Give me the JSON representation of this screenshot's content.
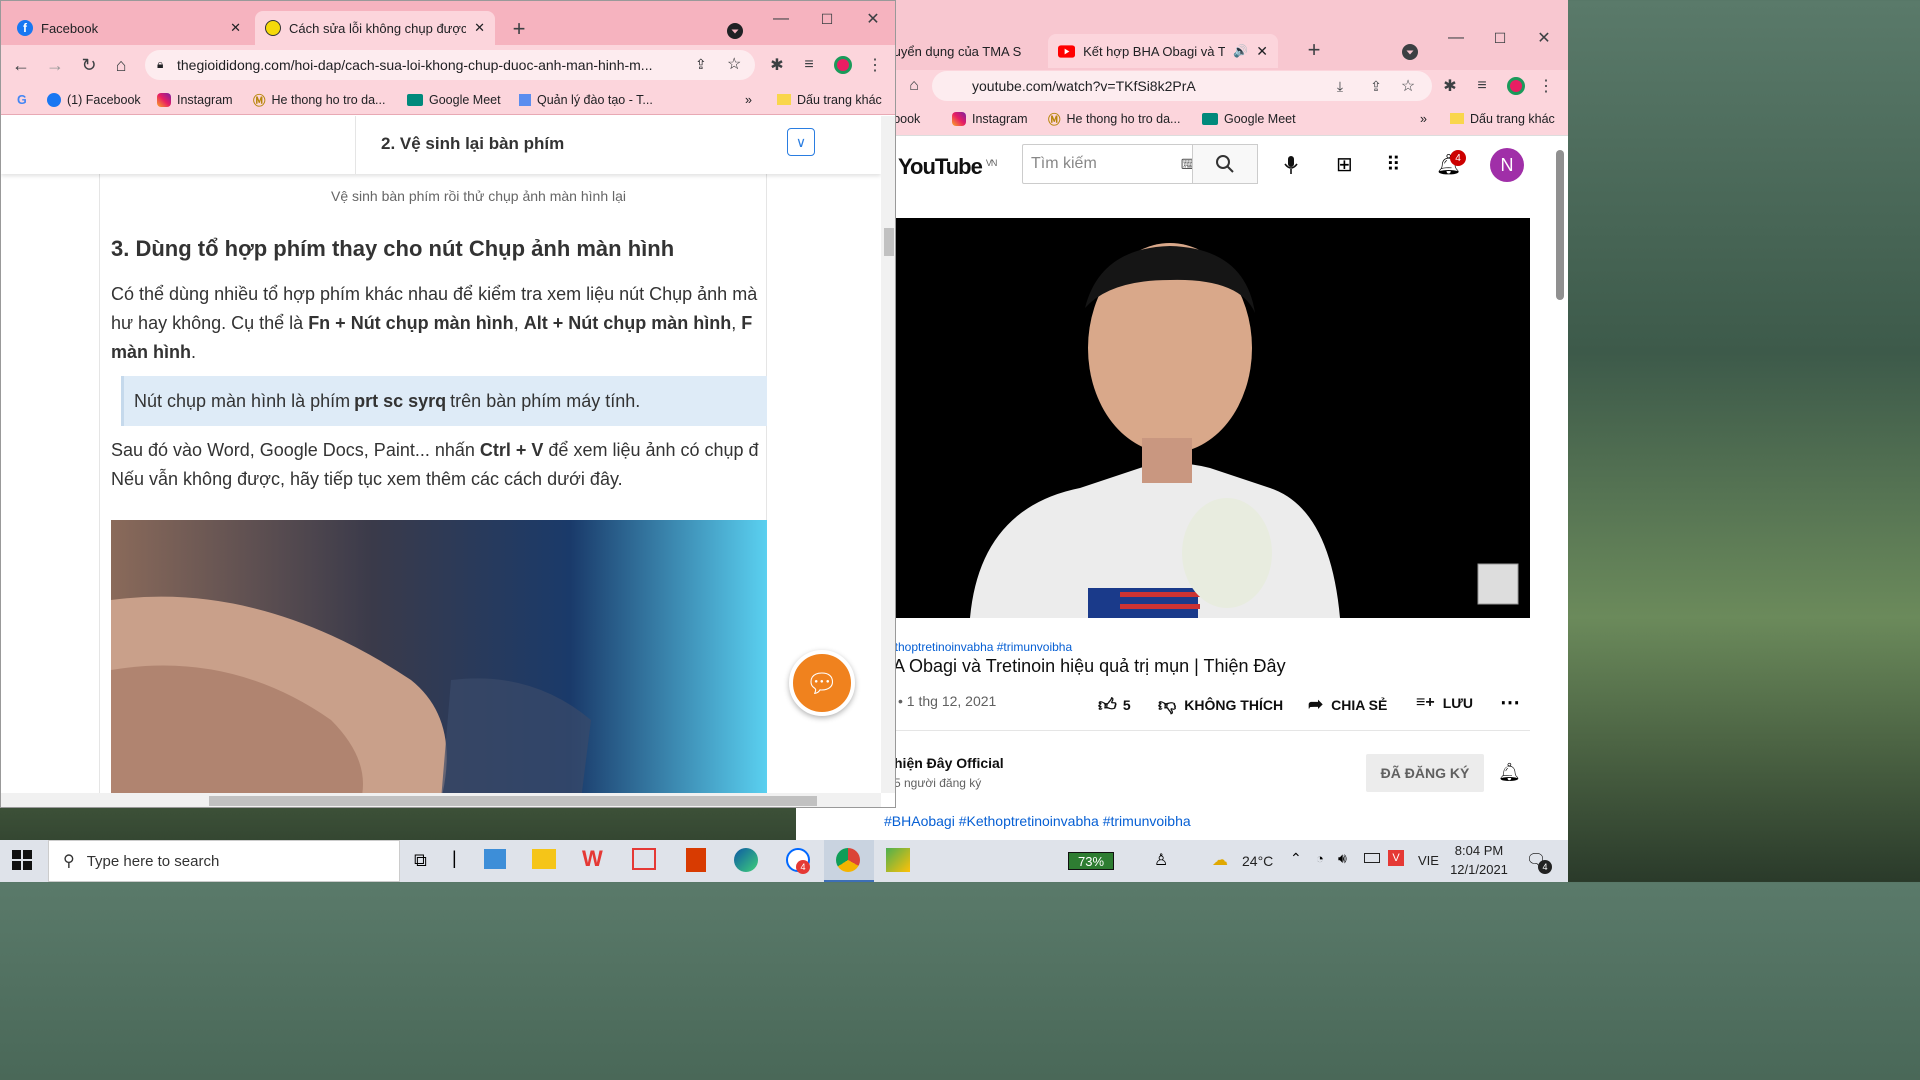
{
  "right_window": {
    "tabs": [
      {
        "label": "tuyển dụng của TMA S"
      },
      {
        "label": "Kết hợp BHA Obagi và Tretin"
      }
    ],
    "url": "youtube.com/watch?v=TKfSi8k2PrA",
    "bookmarks": [
      "cebook",
      "Instagram",
      "He thong ho tro da...",
      "Google Meet",
      "»",
      "Dấu trang khác"
    ],
    "yt": {
      "logo": "YouTube",
      "region": "VN",
      "search_placeholder": "Tìm kiếm",
      "notif_count": "4",
      "avatar_letter": "N",
      "hashtags": "Kethoptretinoinvabha #trimunvoibha",
      "title": "HA Obagi và Tretinoin hiệu quả trị mụn | Thiện Đây",
      "date": "• 1 thg 12, 2021",
      "likes": "5",
      "dislike": "KHÔNG THÍCH",
      "share": "CHIA SẺ",
      "save": "LƯU",
      "channel": "hiện Đây Official",
      "subs": "5 người đăng ký",
      "subscribed": "ĐÃ ĐĂNG KÝ",
      "desc_tags": "#BHAobagi #Kethoptretinoinvabha #trimunvoibha"
    }
  },
  "left_window": {
    "tabs": [
      {
        "label": "Facebook"
      },
      {
        "label": "Cách sửa lỗi không chụp được ản"
      }
    ],
    "url": "thegioididong.com/hoi-dap/cach-sua-loi-khong-chup-duoc-anh-man-hinh-m...",
    "bookmarks": [
      "(1) Facebook",
      "Instagram",
      "He thong ho tro da...",
      "Google Meet",
      "Quản lý đào tạo - T...",
      "»",
      "Dấu trang khác"
    ],
    "toc_heading": "2. Vệ sinh lại bàn phím",
    "caption": "Vệ sinh bàn phím rồi thử chụp ảnh màn hình lại",
    "h3": "3. Dùng tổ hợp phím thay cho nút Chụp ảnh màn hình",
    "p1_a": "Có thể dùng nhiều tổ hợp phím khác nhau để kiểm tra xem liệu nút Chụp ảnh mà",
    "p1_b": "hư hay không. Cụ thể là ",
    "p1_bold1": "Fn + Nút chụp màn hình",
    "p1_c": ", ",
    "p1_bold2": "Alt + Nút chụp màn hình",
    "p1_d": ", ",
    "p1_bold3": "F",
    "p1_bold4": "màn hình",
    "p1_e": ".",
    "note_a": "Nút chụp màn hình là phím ",
    "note_bold": "prt sc syrq",
    "note_b": " trên bàn phím máy tính.",
    "p2_a": "Sau đó vào Word, Google Docs, Paint... nhấn ",
    "p2_bold": "Ctrl + V",
    "p2_b": " để xem liệu ảnh có chụp đ",
    "p2_c": "Nếu vẫn không được, hãy tiếp tục xem thêm các cách dưới đây."
  },
  "taskbar": {
    "search_placeholder": "Type here to search",
    "battery": "73%",
    "weather": "24°C",
    "lang": "VIE",
    "time": "8:04 PM",
    "date": "12/1/2021",
    "notif": "4",
    "zalo_badge": "4"
  }
}
